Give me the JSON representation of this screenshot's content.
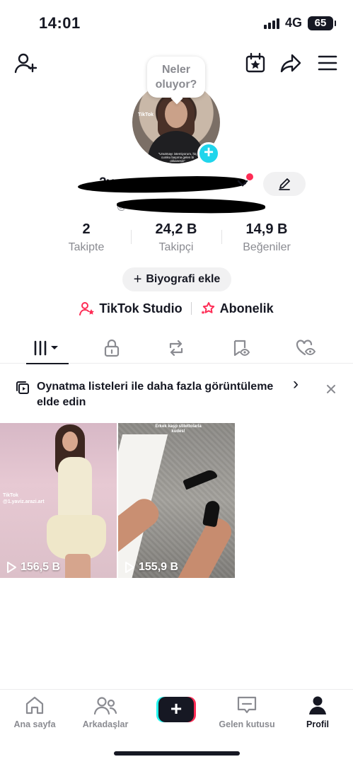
{
  "status_bar": {
    "time": "14:01",
    "network": "4G",
    "battery": "65"
  },
  "profile": {
    "prompt_bubble": "Neler oluyor?",
    "avatar_watermark": "TikTok",
    "avatar_caption": "\"Unutmayı istemiyorum, hiç cumku başıma gelen bi okkanesin\"",
    "username": "2ya",
    "handle": "@",
    "add_avatar": "+"
  },
  "stats": [
    {
      "value": "2",
      "label": "Takipte"
    },
    {
      "value": "24,2 B",
      "label": "Takipçi"
    },
    {
      "value": "14,9 B",
      "label": "Beğeniler"
    }
  ],
  "bio_button": {
    "plus": "+",
    "label": "Biyografi ekle"
  },
  "links": {
    "studio": "TikTok Studio",
    "subscription": "Abonelik"
  },
  "banner": {
    "text": "Oynatma listeleri ile daha fazla görüntüleme elde edin",
    "chevron": "›"
  },
  "videos": [
    {
      "views": "156,5 B",
      "watermark": "TikTok\n@1.yaviz.arazi.art"
    },
    {
      "views": "155,9 B",
      "caption": "Erkek kaşp stilettolarla kudes!"
    }
  ],
  "bottom_nav": [
    {
      "label": "Ana sayfa"
    },
    {
      "label": "Arkadaşlar"
    },
    {
      "label": "+"
    },
    {
      "label": "Gelen kutusu"
    },
    {
      "label": "Profil"
    }
  ],
  "colors": {
    "accent_pink": "#fe2c55",
    "accent_cyan": "#25f4ee",
    "avatar_plus": "#20d5ec",
    "text": "#161823",
    "muted": "#8a8b91"
  }
}
